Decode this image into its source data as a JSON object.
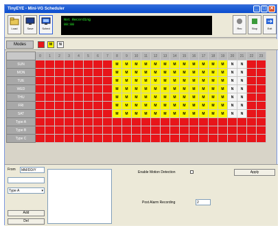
{
  "window": {
    "title": "TinyEYE - Mini-VG Scheduler",
    "min": "_",
    "max": "□",
    "close": "✕"
  },
  "toolbar": {
    "buttons": [
      {
        "label": "Load",
        "icon": "folder-icon"
      },
      {
        "label": "Save",
        "icon": "monitor-icon"
      },
      {
        "label": "Sched",
        "icon": "screen-icon"
      }
    ],
    "status_line1": "Not Recording",
    "status_line2": "00:00",
    "right_buttons": [
      {
        "label": "Rec",
        "icon": "record-icon"
      },
      {
        "label": "Stop",
        "icon": "stop-icon"
      },
      {
        "label": "Exit",
        "icon": "exit-icon"
      }
    ]
  },
  "modes": {
    "label": "Modes",
    "swatches": [
      {
        "name": "red",
        "color": "#e8151a",
        "text": ""
      },
      {
        "name": "yellow",
        "color": "#f8f400",
        "text": "M"
      },
      {
        "name": "white",
        "color": "#f4f4f4",
        "text": "N"
      }
    ]
  },
  "schedule": {
    "hours": [
      "0",
      "1",
      "2",
      "3",
      "4",
      "5",
      "6",
      "7",
      "8",
      "9",
      "10",
      "11",
      "12",
      "13",
      "14",
      "15",
      "16",
      "17",
      "18",
      "19",
      "20",
      "21",
      "22",
      "23"
    ],
    "days": [
      "SUN",
      "MON",
      "TUE",
      "WED",
      "THU",
      "FRI",
      "SAT",
      "Type A",
      "Type B",
      "Type C"
    ],
    "rows": [
      "RRRRRRRRMMMMMMMMMMMMNNRR",
      "RRRRRRRRMMMMMMMMMMMMNNRR",
      "RRRRRRRRMMMMMMMMMMMMNNRR",
      "RRRRRRRRMMMMMMMMMMMMNNRR",
      "RRRRRRRRMMMMMMMMMMMMNNRR",
      "RRRRRRRRMMMMMMMMMMMMNNRR",
      "RRRRRRRRMMMMMMMMMMMMNNRR",
      "RRRRRRRRRRRRRRRRRRRRRRRR",
      "RRRRRRRRRRRRRRRRRRRRRRRR",
      "RRRRRRRRRRRRRRRRRRRRRRRR"
    ],
    "colors": {
      "R": "#e8151a",
      "M": "#f8f400",
      "N": "#f4f4f4"
    }
  },
  "controls": {
    "from_label": "From",
    "from_value": "MM/DD/Y",
    "date_value": "",
    "type_value": "Type A",
    "add_label": "Add",
    "del_label": "Del",
    "motion_label": "Enable Motion Detection",
    "apply_label": "Apply",
    "post_alarm_label": "Post Alarm Recording",
    "post_alarm_value": "2"
  }
}
